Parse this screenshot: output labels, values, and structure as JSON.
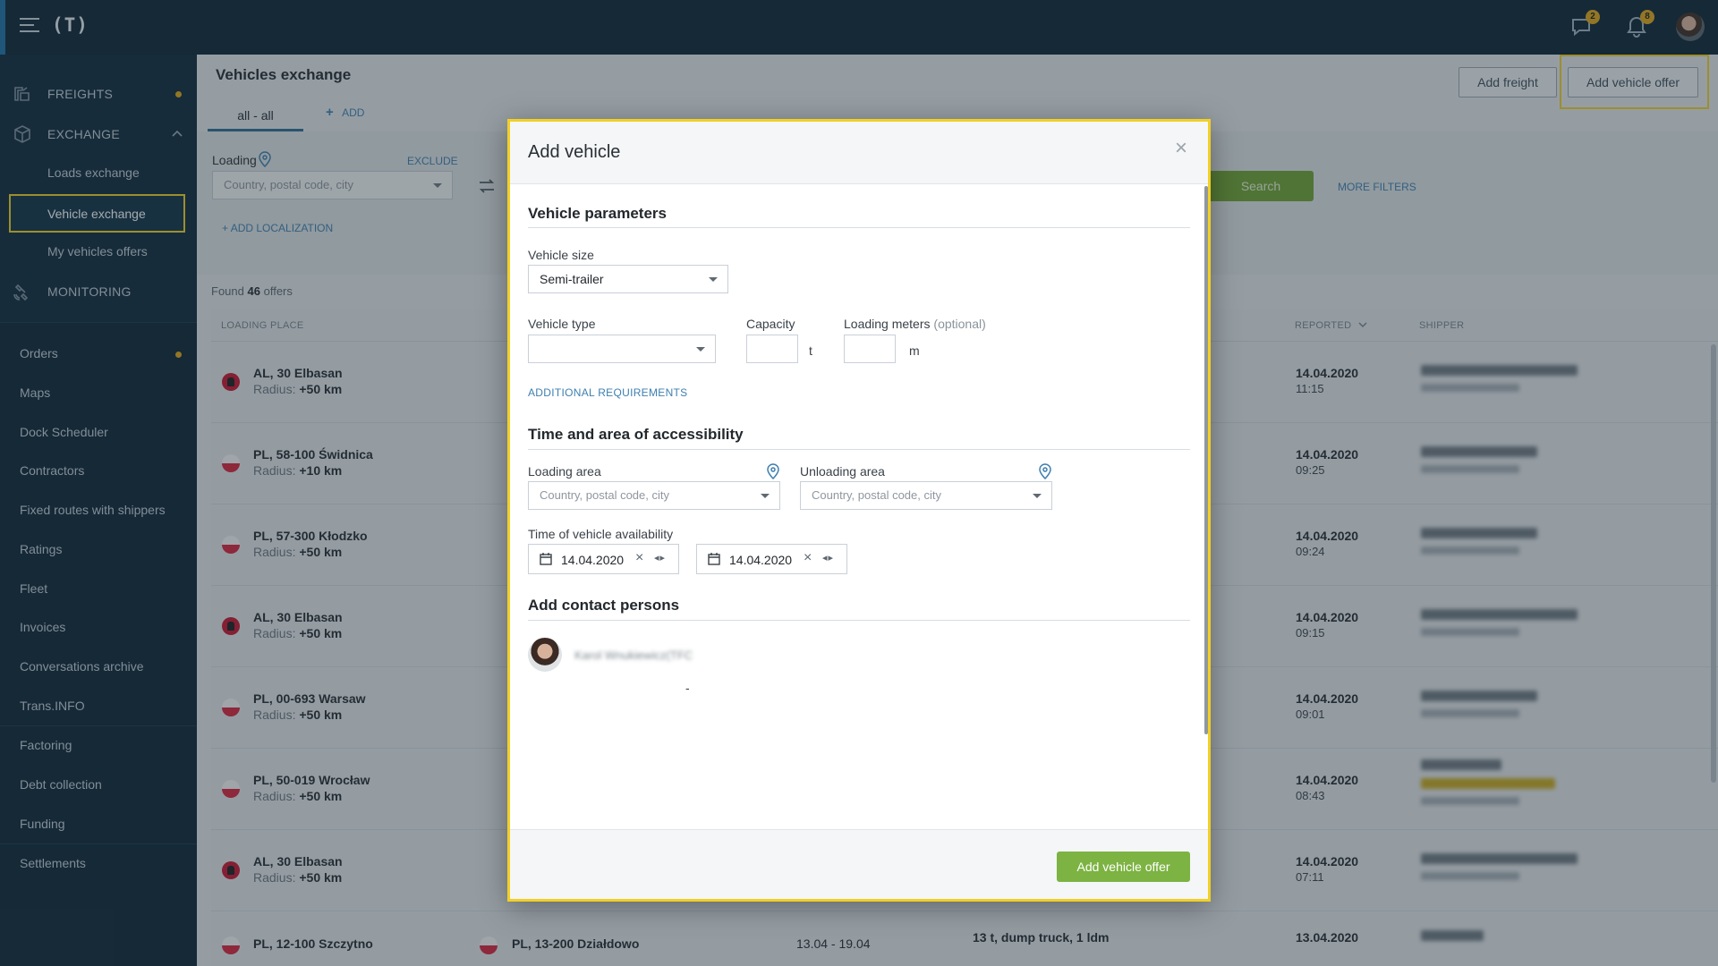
{
  "topbar": {
    "logo": "(T)",
    "messages_count": "2",
    "notifications_count": "8"
  },
  "sidebar": {
    "sections": [
      {
        "label": "FREIGHTS",
        "icon": "freight-icon"
      },
      {
        "label": "EXCHANGE",
        "icon": "exchange-box-icon"
      },
      {
        "label": "MONITORING",
        "icon": "satellite-icon"
      }
    ],
    "exchange_items": [
      "Loads exchange",
      "Vehicle exchange",
      "My vehicles offers"
    ],
    "items": [
      "Orders",
      "Maps",
      "Dock Scheduler",
      "Contractors",
      "Fixed routes with shippers",
      "Ratings",
      "Fleet",
      "Invoices",
      "Conversations archive",
      "Trans.INFO",
      "Factoring",
      "Debt collection",
      "Funding",
      "Settlements"
    ]
  },
  "page": {
    "title": "Vehicles exchange",
    "tab_all": "all - all",
    "tab_add": "ADD",
    "add_freight": "Add freight",
    "add_vehicle_offer": "Add vehicle offer"
  },
  "filters": {
    "loading_label": "Loading",
    "exclude": "EXCLUDE",
    "placeholder": "Country, postal code, city",
    "add_localization": "ADD LOCALIZATION",
    "search": "Search",
    "more_filters": "MORE FILTERS"
  },
  "results": {
    "found_prefix": "Found",
    "count": "46",
    "found_suffix": "offers"
  },
  "table": {
    "headers": {
      "loading_place": "LOADING PLACE",
      "reported": "REPORTED",
      "shipper": "SHIPPER"
    },
    "rows": [
      {
        "flag": "AL",
        "place": "AL, 30 Elbasan",
        "radius_label": "Radius:",
        "radius": "+50 km",
        "date": "14.04.2020",
        "time": "11:15"
      },
      {
        "flag": "PL",
        "place": "PL, 58-100 Świdnica",
        "radius_label": "Radius:",
        "radius": "+10 km",
        "date": "14.04.2020",
        "time": "09:25"
      },
      {
        "flag": "PL",
        "place": "PL, 57-300 Kłodzko",
        "radius_label": "Radius:",
        "radius": "+50 km",
        "date": "14.04.2020",
        "time": "09:24"
      },
      {
        "flag": "AL",
        "place": "AL, 30 Elbasan",
        "radius_label": "Radius:",
        "radius": "+50 km",
        "date": "14.04.2020",
        "time": "09:15"
      },
      {
        "flag": "PL",
        "place": "PL, 00-693 Warsaw",
        "radius_label": "Radius:",
        "radius": "+50 km",
        "date": "14.04.2020",
        "time": "09:01"
      },
      {
        "flag": "PL",
        "place": "PL, 50-019 Wrocław",
        "radius_label": "Radius:",
        "radius": "+50 km",
        "date": "14.04.2020",
        "time": "08:43"
      },
      {
        "flag": "AL",
        "place": "AL, 30 Elbasan",
        "radius_label": "Radius:",
        "radius": "+50 km",
        "date": "14.04.2020",
        "time": "07:11"
      }
    ],
    "last_row": {
      "loading": "PL, 12-100 Szczytno",
      "unloading": "PL, 13-200 Działdowo",
      "dates": "13.04 - 19.04",
      "vehicle": "13 t, dump truck, 1 ldm",
      "date": "13.04.2020"
    }
  },
  "modal": {
    "title": "Add vehicle",
    "section_vehicle": "Vehicle parameters",
    "vehicle_size_label": "Vehicle size",
    "vehicle_size_value": "Semi-trailer",
    "vehicle_type_label": "Vehicle type",
    "capacity_label": "Capacity",
    "capacity_unit": "t",
    "loading_meters_label": "Loading meters",
    "optional": "(optional)",
    "loading_meters_unit": "m",
    "additional_requirements": "ADDITIONAL REQUIREMENTS",
    "section_time": "Time and area of accessibility",
    "loading_area_label": "Loading area",
    "unloading_area_label": "Unloading area",
    "area_placeholder": "Country, postal code, city",
    "availability_label": "Time of vehicle availability",
    "date_from": "14.04.2020",
    "date_to": "14.04.2020",
    "dash": "-",
    "section_contacts": "Add contact persons",
    "contact_name": "Karol Wnukiewicz(TFC",
    "submit": "Add vehicle offer"
  }
}
